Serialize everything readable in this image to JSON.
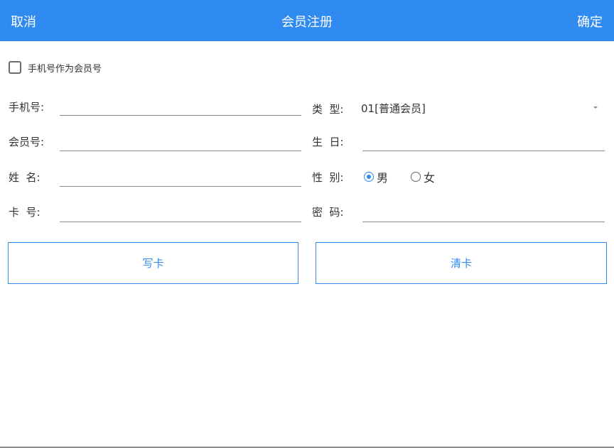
{
  "header": {
    "cancel_label": "取消",
    "title": "会员注册",
    "confirm_label": "确定"
  },
  "phone_as_member_id": {
    "label": "手机号作为会员号",
    "checked": false
  },
  "form": {
    "phone": {
      "label": "手机号:",
      "value": ""
    },
    "member_no": {
      "label": "会员号:",
      "value": ""
    },
    "name": {
      "label": "姓  名:",
      "value": ""
    },
    "card_no": {
      "label": "卡  号:",
      "value": ""
    },
    "type": {
      "label": "类  型:",
      "selected": "01[普通会员]"
    },
    "birthday": {
      "label": "生  日:",
      "value": ""
    },
    "gender": {
      "label": "性  别:",
      "options": [
        "男",
        "女"
      ],
      "selected": "男"
    },
    "password": {
      "label": "密  码:",
      "value": ""
    }
  },
  "buttons": {
    "write_card": "写卡",
    "clear_card": "清卡"
  },
  "colors": {
    "accent": "#2f8bf0",
    "text": "#333333",
    "underline": "#8c8c8c"
  }
}
